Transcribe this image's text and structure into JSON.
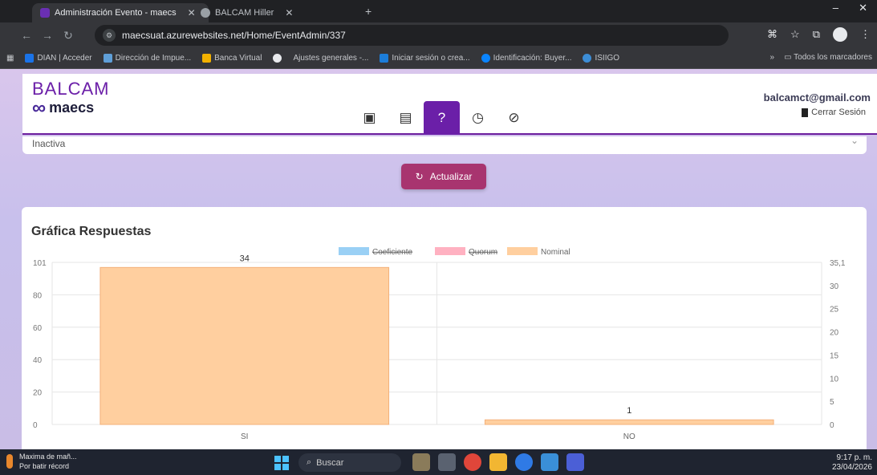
{
  "browser": {
    "tabs": [
      {
        "title": "Administración Evento - maecs",
        "active": true
      },
      {
        "title": "BALCAM Hiller",
        "active": false
      }
    ],
    "url": "maecsuat.azurewebsites.net/Home/EventAdmin/337",
    "bookmarks": [
      {
        "label": "DIAN | Acceder",
        "color": "#1a73e8"
      },
      {
        "label": "Dirección de Impue...",
        "color": "#5f9fd8"
      },
      {
        "label": "Banca Virtual",
        "color": "#f2b100"
      },
      {
        "label": "",
        "color": "#e8eaed"
      },
      {
        "label": "Ajustes generales -...",
        "color": ""
      },
      {
        "label": "Iniciar sesión o crea...",
        "color": "#1c7dd9"
      },
      {
        "label": "Identificación: Buyer...",
        "color": "#0a84ff"
      },
      {
        "label": "ISIIGO",
        "color": "#3c8dd6"
      }
    ],
    "bookmarks_overflow": "»",
    "all_bookmarks": "Todos los marcadores"
  },
  "app": {
    "brand_top": "BALCAM",
    "brand_bottom": "maecs",
    "user_email": "balcamct@gmail.com",
    "logout": "Cerrar Sesión",
    "nav_icons": [
      "calendar-icon",
      "document-icon",
      "question-icon",
      "timer-icon",
      "cancel-icon"
    ],
    "status": "Inactiva",
    "refresh_label": "Actualizar",
    "accent": "#6b1fa8",
    "button_color": "#a8346f"
  },
  "chart_title": "Gráfica Respuestas",
  "chart_data": {
    "type": "bar",
    "categories": [
      "SI",
      "NO"
    ],
    "series": [
      {
        "name": "Coeficiente",
        "values": [],
        "color": "#9ad0f5",
        "hidden": true
      },
      {
        "name": "Quorum",
        "values": [],
        "color": "#ffb1c1",
        "hidden": true
      },
      {
        "name": "Nominal",
        "values": [
          34,
          1
        ],
        "color": "#ffcf9f",
        "hidden": false
      }
    ],
    "data_labels": [
      "34",
      "1"
    ],
    "y_left": {
      "ticks": [
        "0",
        "20",
        "40",
        "60",
        "80",
        "101"
      ],
      "range": [
        0,
        101
      ]
    },
    "y_right": {
      "ticks": [
        "0",
        "5",
        "10",
        "15",
        "20",
        "25",
        "30",
        "35,1"
      ],
      "range": [
        0,
        35.1
      ]
    },
    "legend_position": "top"
  },
  "taskbar": {
    "weather_line1": "Maxima de mañ...",
    "weather_line2": "Por batir récord",
    "search": "Buscar",
    "time": "9:17 p. m.",
    "date": "23/04/2026"
  }
}
